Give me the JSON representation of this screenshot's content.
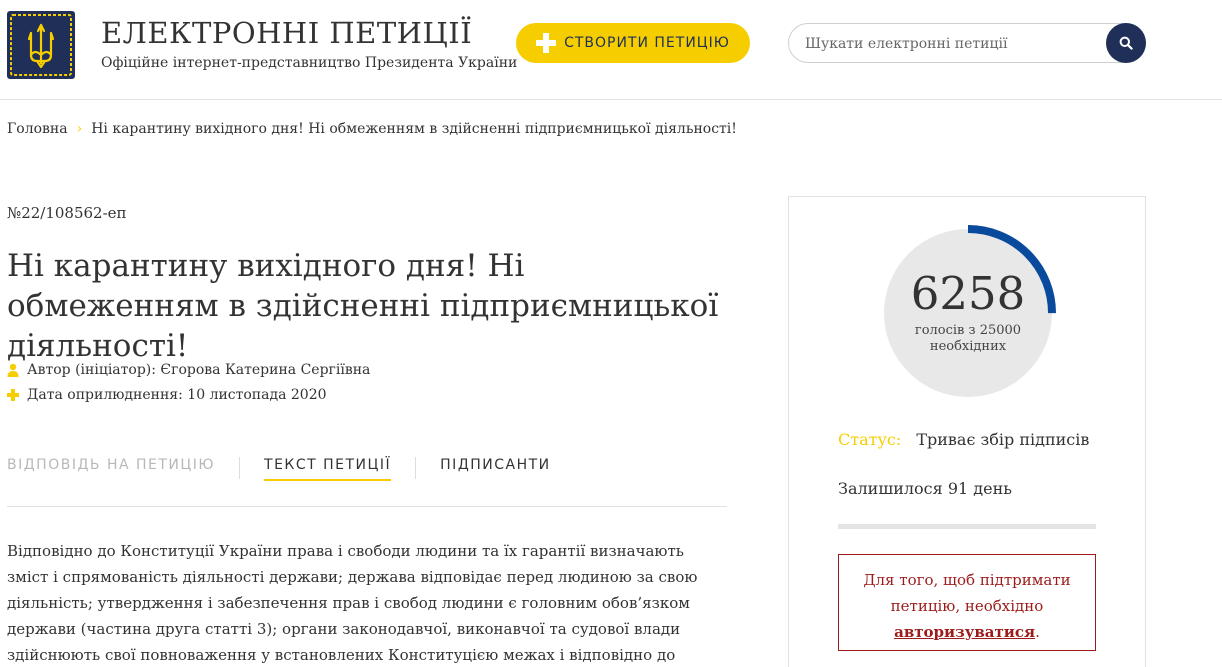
{
  "header": {
    "site_title": "ЕЛЕКТРОННІ ПЕТИЦІЇ",
    "site_subtitle": "Офіційне інтернет-представництво Президента України",
    "create_button_label": "СТВОРИТИ ПЕТИЦІЮ",
    "search_placeholder": "Шукати електронні петиції"
  },
  "breadcrumb": {
    "home": "Головна",
    "separator": "›",
    "current": "Ні карантину вихідного дня! Ні обмеженням в здійсненні підприємницької діяльності!"
  },
  "petition": {
    "number": "№22/108562-еп",
    "title": "Ні карантину вихідного дня! Ні обмеженням в здійсненні підприємницької діяльності!",
    "author": "Автор (ініціатор): Єгорова Катерина Сергіївна",
    "date": "Дата оприлюднення: 10 листопада 2020",
    "tabs": [
      "ВІДПОВІДЬ НА ПЕТИЦІЮ",
      "ТЕКСТ ПЕТИЦІЇ",
      "ПІДПИСАНТИ"
    ],
    "active_tab": "ТЕКСТ ПЕТИЦІЇ",
    "text": "Відповідно до Конституції України права і свободи людини та їх гарантії визначають зміст і спрямованість діяльності держави; держава відповідає перед людиною за свою діяльність; утвердження і забезпечення прав і свобод людини є головним обов’язком держави (частина друга статті 3); органи законодавчої, виконавчої та судової влади здійснюють свої повноваження у встановлених Конституцією межах і відповідно до законів України (частина"
  },
  "sidebar": {
    "votes": 6258,
    "votes_label": "голосів з 25000 необхідних",
    "votes_needed": 25000,
    "status_label": "Статус:",
    "status_value": "Триває збір підписів",
    "remaining": "Залишилося 91 день",
    "time_progress": 0,
    "auth_text_before": "Для того, щоб підтримати петицію, необхідно",
    "auth_link": "авторизуватися",
    "auth_text_after": "."
  },
  "colors": {
    "accent_yellow": "#f6ce00",
    "navy": "#1f2f57",
    "progress_blue": "#0a4a9c",
    "auth_red": "#9c1c1c"
  },
  "icons": {
    "logo": "trident-icon",
    "search": "search-icon",
    "plus": "plus-icon",
    "author": "person-icon",
    "date": "plus-icon"
  }
}
